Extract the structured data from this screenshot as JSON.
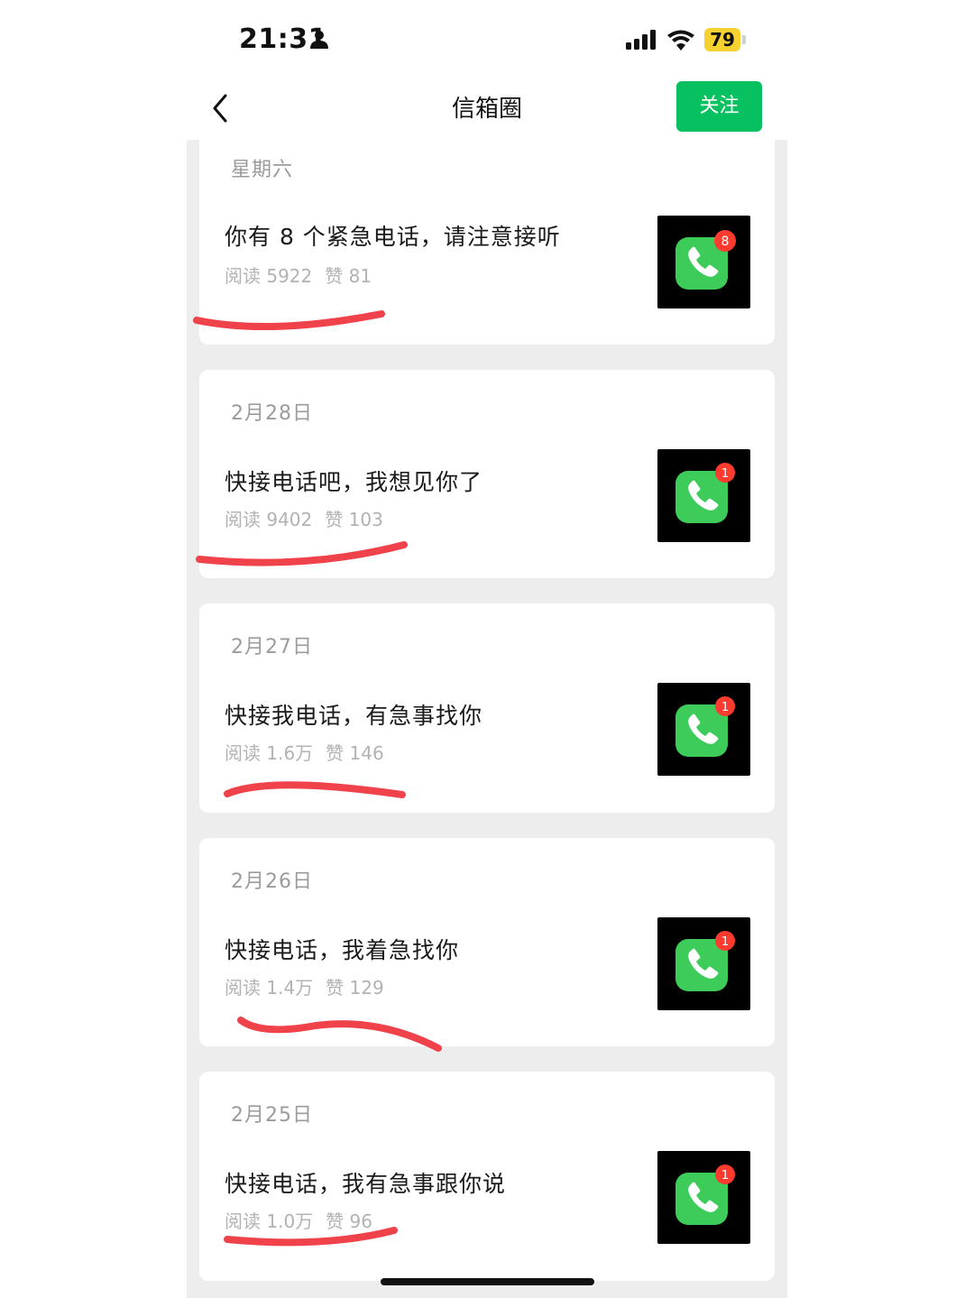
{
  "status_bar": {
    "time": "21:31",
    "battery": "79",
    "icons": [
      "person-icon",
      "signal-icon",
      "wifi-icon",
      "battery-icon"
    ]
  },
  "nav": {
    "back_icon": "chevron-left-icon",
    "title": "信箱圈",
    "follow_label": "关注",
    "accent_color": "#07c160"
  },
  "posts": [
    {
      "date": "星期六",
      "title": "你有 8 个紧急电话，请注意接听",
      "reads": "阅读 5922",
      "likes": "赞 81",
      "thumb_badge": "8",
      "thumb_icon": "phone-app-icon"
    },
    {
      "date": "2月28日",
      "title": "快接电话吧，我想见你了",
      "reads": "阅读 9402",
      "likes": "赞 103",
      "thumb_badge": "1",
      "thumb_icon": "phone-app-icon"
    },
    {
      "date": "2月27日",
      "title": "快接我电话，有急事找你",
      "reads": "阅读 1.6万",
      "likes": "赞 146",
      "thumb_badge": "1",
      "thumb_icon": "phone-app-icon"
    },
    {
      "date": "2月26日",
      "title": "快接电话，我着急找你",
      "reads": "阅读 1.4万",
      "likes": "赞 129",
      "thumb_badge": "1",
      "thumb_icon": "phone-app-icon"
    },
    {
      "date": "2月25日",
      "title": "快接电话，我有急事跟你说",
      "reads": "阅读 1.0万",
      "likes": "赞 96",
      "thumb_badge": "1",
      "thumb_icon": "phone-app-icon"
    }
  ],
  "annotation_color": "#f0424a"
}
